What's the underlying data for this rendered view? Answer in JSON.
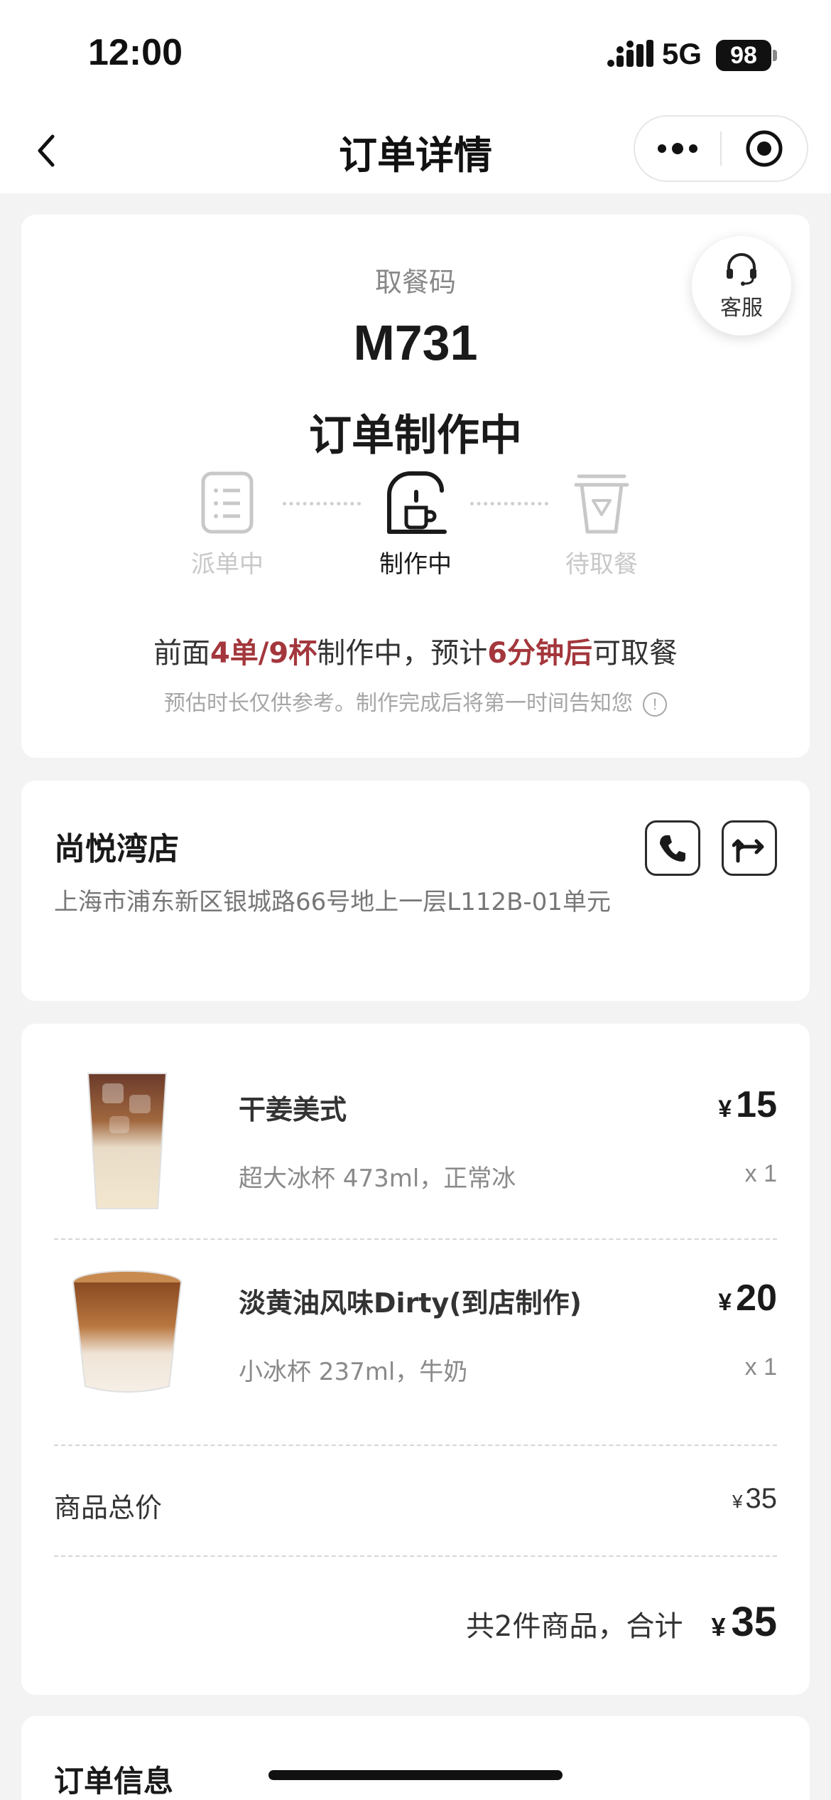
{
  "status_bar": {
    "time": "12:00",
    "network": "5G",
    "battery": "98"
  },
  "nav": {
    "title": "订单详情",
    "back_icon": "chevron-left-icon",
    "more_icon": "more-dots-icon",
    "close_icon": "target-circle-icon"
  },
  "pickup": {
    "service_label": "客服",
    "label": "取餐码",
    "code": "M731",
    "status": "订单制作中",
    "steps": [
      {
        "label": "派单中",
        "icon": "order-list-icon",
        "active": false
      },
      {
        "label": "制作中",
        "icon": "coffee-machine-icon",
        "active": true
      },
      {
        "label": "待取餐",
        "icon": "cup-icon",
        "active": false
      }
    ],
    "queue": {
      "prefix": "前面",
      "count": "4单/9杯",
      "middle": "制作中，预计",
      "time": "6分钟后",
      "suffix": "可取餐"
    },
    "note": "预估时长仅供参考。制作完成后将第一时间告知您",
    "colors": {
      "highlight": "#a3373c",
      "inactive": "#c8c8c8"
    }
  },
  "store": {
    "name": "尚悦湾店",
    "address": "上海市浦东新区银城路66号地上一层L112B-01单元",
    "phone_icon": "phone-icon",
    "nav_icon": "directions-icon"
  },
  "items": [
    {
      "name": "干姜美式",
      "spec": "超大冰杯 473ml，正常冰",
      "currency": "¥",
      "price": "15",
      "qty": "x 1"
    },
    {
      "name": "淡黄油风味Dirty(到店制作)",
      "spec": "小冰杯 237ml，牛奶",
      "currency": "¥",
      "price": "20",
      "qty": "x 1"
    }
  ],
  "summary": {
    "subtotal_label": "商品总价",
    "subtotal_currency": "¥",
    "subtotal_value": "35",
    "total_text": "共2件商品，合计",
    "total_currency": "¥",
    "total_value": "35"
  },
  "order_info": {
    "title": "订单信息"
  }
}
